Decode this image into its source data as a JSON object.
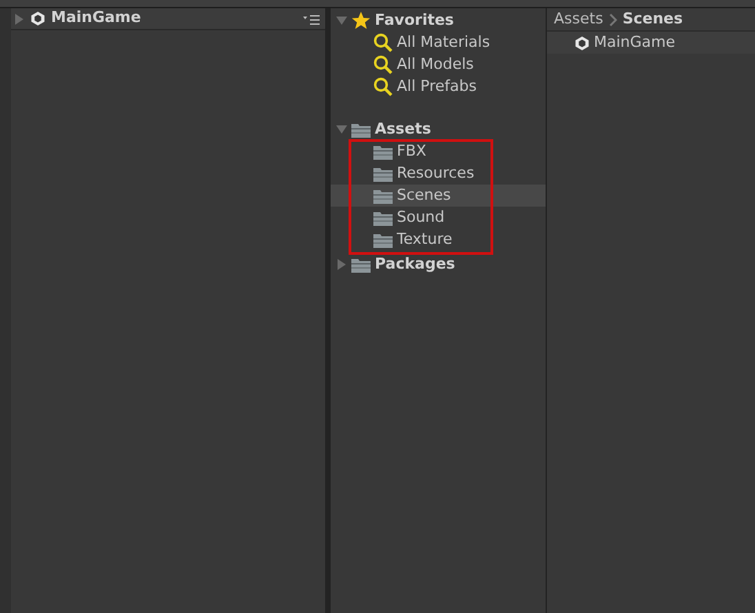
{
  "hierarchy": {
    "scene": {
      "name": "MainGame",
      "expanded": false
    }
  },
  "project": {
    "tree": [
      {
        "label": "Favorites",
        "kind": "favorites",
        "expanded": true,
        "selected": false,
        "children": [
          {
            "label": "All Materials",
            "kind": "search",
            "selected": false
          },
          {
            "label": "All Models",
            "kind": "search",
            "selected": false
          },
          {
            "label": "All Prefabs",
            "kind": "search",
            "selected": false
          }
        ]
      },
      {
        "label": "Assets",
        "kind": "folder",
        "expanded": true,
        "selected": false,
        "children": [
          {
            "label": "FBX",
            "kind": "folder",
            "selected": false
          },
          {
            "label": "Resources",
            "kind": "folder",
            "selected": false
          },
          {
            "label": "Scenes",
            "kind": "folder",
            "selected": true
          },
          {
            "label": "Sound",
            "kind": "folder",
            "selected": false
          },
          {
            "label": "Texture",
            "kind": "folder",
            "selected": false
          }
        ]
      },
      {
        "label": "Packages",
        "kind": "folder",
        "expanded": false,
        "selected": false
      }
    ],
    "breadcrumb": [
      "Assets",
      "Scenes"
    ],
    "items": [
      {
        "name": "MainGame",
        "kind": "scene"
      }
    ]
  }
}
